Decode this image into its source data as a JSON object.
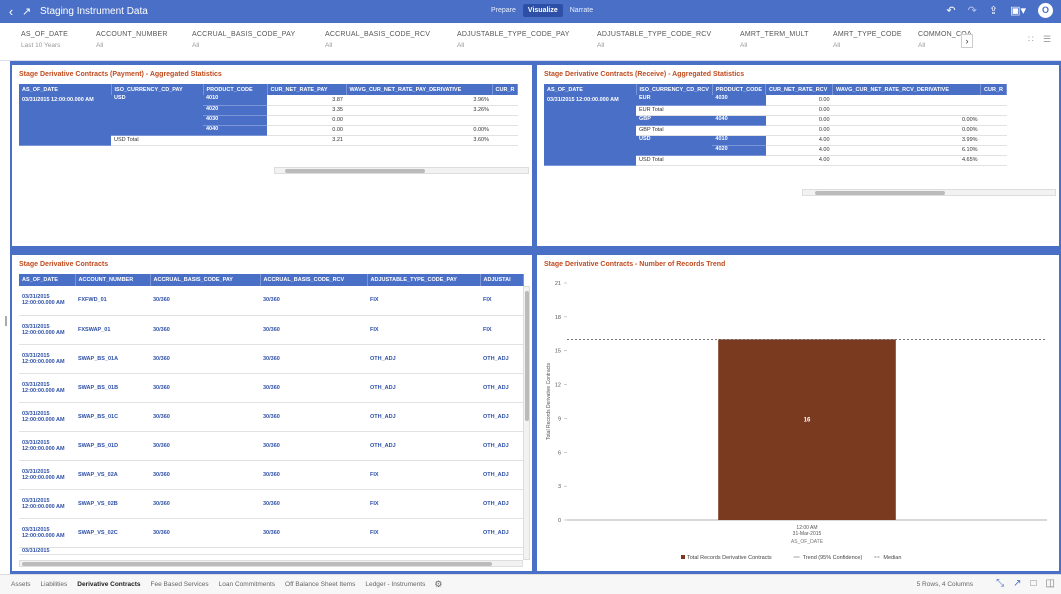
{
  "header": {
    "back_icon": "back-chevron-icon",
    "title": "Staging Instrument Data",
    "modes": [
      "Prepare",
      "Visualize",
      "Narrate"
    ],
    "active_mode": "Visualize",
    "icons": [
      "undo-icon",
      "redo-icon",
      "share-icon",
      "save-icon",
      "avatar-icon"
    ],
    "avatar_letter": "O",
    "accent": "#4a6fc7"
  },
  "filters": [
    {
      "label": "AS_OF_DATE",
      "value": "Last 10 Years"
    },
    {
      "label": "ACCOUNT_NUMBER",
      "value": "All"
    },
    {
      "label": "ACCRUAL_BASIS_CODE_PAY",
      "value": "All"
    },
    {
      "label": "ACCRUAL_BASIS_CODE_RCV",
      "value": "All"
    },
    {
      "label": "ADJUSTABLE_TYPE_CODE_PAY",
      "value": "All"
    },
    {
      "label": "ADJUSTABLE_TYPE_CODE_RCV",
      "value": "All"
    },
    {
      "label": "AMRT_TERM_MULT",
      "value": "All"
    },
    {
      "label": "AMRT_TYPE_CODE",
      "value": "All"
    },
    {
      "label": "COMMON_COA",
      "value": "All"
    }
  ],
  "payment_panel": {
    "title": "Stage Derivative Contracts (Payment) - Aggregated Statistics",
    "columns": [
      "AS_OF_DATE",
      "ISO_CURRENCY_CD_PAY",
      "PRODUCT_CODE",
      "CUR_NET_RATE_PAY",
      "WAVG_CUR_NET_RATE_PAY_DERIVATIVE",
      "CUR_R"
    ],
    "date": "03/31/2015 12:00:00.000 AM",
    "currency": "USD",
    "rows": [
      {
        "product": "4010",
        "rate": "3.87",
        "wavg": "3.96%"
      },
      {
        "product": "4020",
        "rate": "3.35",
        "wavg": "3.26%"
      },
      {
        "product": "4030",
        "rate": "0.00",
        "wavg": ""
      },
      {
        "product": "4040",
        "rate": "0.00",
        "wavg": "0.00%"
      }
    ],
    "total_label": "USD Total",
    "total_rate": "3.21",
    "total_wavg": "3.60%"
  },
  "receive_panel": {
    "title": "Stage Derivative Contracts (Receive) - Aggregated Statistics",
    "columns": [
      "AS_OF_DATE",
      "ISO_CURRENCY_CD_RCV",
      "PRODUCT_CODE",
      "CUR_NET_RATE_RCV",
      "WAVG_CUR_NET_RATE_RCV_DERIVATIVE",
      "CUR_R"
    ],
    "date": "03/31/2015 12:00:00.000 AM",
    "rows": [
      {
        "currency": "EUR",
        "product": "4030",
        "rate": "0.00",
        "wavg": "",
        "is_total": false
      },
      {
        "currency": "EUR Total",
        "product": "",
        "rate": "0.00",
        "wavg": "",
        "is_total": true
      },
      {
        "currency": "GBP",
        "product": "4040",
        "rate": "0.00",
        "wavg": "0.00%",
        "is_total": false
      },
      {
        "currency": "GBP Total",
        "product": "",
        "rate": "0.00",
        "wavg": "0.00%",
        "is_total": true
      },
      {
        "currency": "USD",
        "product": "4010",
        "rate": "4.00",
        "wavg": "3.99%",
        "is_total": false
      },
      {
        "currency": "",
        "product": "4020",
        "rate": "4.00",
        "wavg": "6.10%",
        "is_total": false
      },
      {
        "currency": "USD Total",
        "product": "",
        "rate": "4.00",
        "wavg": "4.65%",
        "is_total": true
      }
    ]
  },
  "contracts_panel": {
    "title": "Stage Derivative Contracts",
    "columns": [
      "AS_OF_DATE",
      "ACCOUNT_NUMBER",
      "ACCRUAL_BASIS_CODE_PAY",
      "ACCRUAL_BASIS_CODE_RCV",
      "ADJUSTABLE_TYPE_CODE_PAY",
      "ADJUSTAI"
    ],
    "date": "03/31/2015 12:00:00.000 AM",
    "rows": [
      {
        "account": "FXFWD_01",
        "pay": "30/360",
        "rcv": "30/360",
        "adj_pay": "FIX",
        "adj_rcv": "FIX"
      },
      {
        "account": "FXSWAP_01",
        "pay": "30/360",
        "rcv": "30/360",
        "adj_pay": "FIX",
        "adj_rcv": "FIX"
      },
      {
        "account": "SWAP_BS_01A",
        "pay": "30/360",
        "rcv": "30/360",
        "adj_pay": "OTH_ADJ",
        "adj_rcv": "OTH_ADJ"
      },
      {
        "account": "SWAP_BS_01B",
        "pay": "30/360",
        "rcv": "30/360",
        "adj_pay": "OTH_ADJ",
        "adj_rcv": "OTH_ADJ"
      },
      {
        "account": "SWAP_BS_01C",
        "pay": "30/360",
        "rcv": "30/360",
        "adj_pay": "OTH_ADJ",
        "adj_rcv": "OTH_ADJ"
      },
      {
        "account": "SWAP_BS_01D",
        "pay": "30/360",
        "rcv": "30/360",
        "adj_pay": "OTH_ADJ",
        "adj_rcv": "OTH_ADJ"
      },
      {
        "account": "SWAP_VS_02A",
        "pay": "30/360",
        "rcv": "30/360",
        "adj_pay": "FIX",
        "adj_rcv": "OTH_ADJ"
      },
      {
        "account": "SWAP_VS_02B",
        "pay": "30/360",
        "rcv": "30/360",
        "adj_pay": "FIX",
        "adj_rcv": "OTH_ADJ"
      },
      {
        "account": "SWAP_VS_02C",
        "pay": "30/360",
        "rcv": "30/360",
        "adj_pay": "FIX",
        "adj_rcv": "OTH_ADJ"
      }
    ],
    "partial_row_date": "03/31/2015"
  },
  "trend_panel": {
    "title": "Stage Derivative Contracts - Number of Records Trend"
  },
  "chart_data": {
    "type": "bar",
    "categories": [
      "12:00 AM|31-Mar-2015"
    ],
    "values": [
      16
    ],
    "value_label": "16",
    "ylim": [
      0,
      21
    ],
    "yticks": [
      0,
      3,
      6,
      9,
      12,
      15,
      18,
      21
    ],
    "xlabel": "AS_OF_DATE",
    "ylabel": "Total Records Derivative Contracts",
    "median": 16,
    "bar_color": "#7a3a1f",
    "legend": [
      {
        "label": "Total Records Derivative Contracts",
        "kind": "swatch"
      },
      {
        "label": "Trend (95% Confidence)",
        "kind": "line"
      },
      {
        "label": "Median",
        "kind": "dash"
      }
    ],
    "legend_position": "bottom"
  },
  "footer": {
    "tabs": [
      "Assets",
      "Liabilities",
      "Derivative Contracts",
      "Fee Based Services",
      "Loan Commitments",
      "Off Balance Sheet Items",
      "Ledger - Instruments"
    ],
    "active_tab": "Derivative Contracts",
    "status": "5 Rows, 4 Columns"
  }
}
